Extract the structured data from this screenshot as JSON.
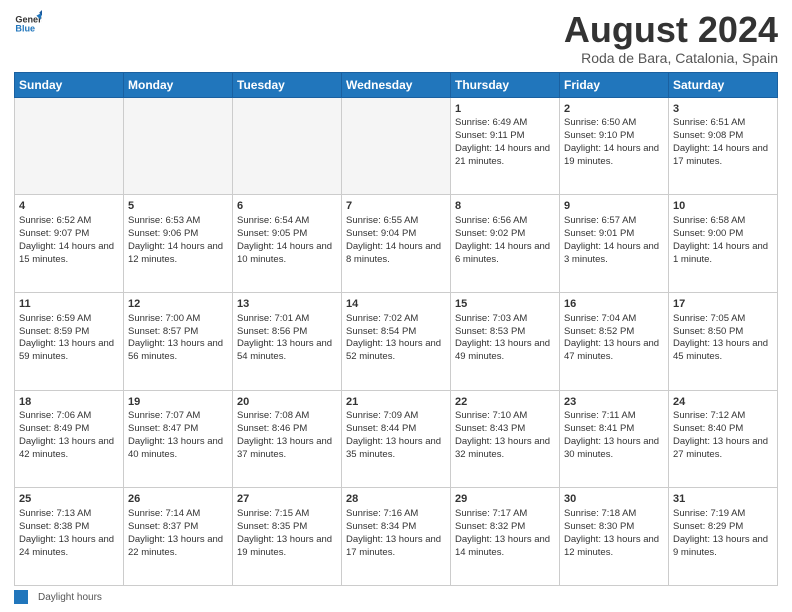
{
  "header": {
    "logo_line1": "General",
    "logo_line2": "Blue",
    "title": "August 2024",
    "subtitle": "Roda de Bara, Catalonia, Spain"
  },
  "days_of_week": [
    "Sunday",
    "Monday",
    "Tuesday",
    "Wednesday",
    "Thursday",
    "Friday",
    "Saturday"
  ],
  "footer": {
    "legend_label": "Daylight hours"
  },
  "weeks": [
    {
      "days": [
        {
          "num": "",
          "info": "",
          "empty": true
        },
        {
          "num": "",
          "info": "",
          "empty": true
        },
        {
          "num": "",
          "info": "",
          "empty": true
        },
        {
          "num": "",
          "info": "",
          "empty": true
        },
        {
          "num": "1",
          "info": "Sunrise: 6:49 AM\nSunset: 9:11 PM\nDaylight: 14 hours and 21 minutes.",
          "empty": false
        },
        {
          "num": "2",
          "info": "Sunrise: 6:50 AM\nSunset: 9:10 PM\nDaylight: 14 hours and 19 minutes.",
          "empty": false
        },
        {
          "num": "3",
          "info": "Sunrise: 6:51 AM\nSunset: 9:08 PM\nDaylight: 14 hours and 17 minutes.",
          "empty": false
        }
      ]
    },
    {
      "days": [
        {
          "num": "4",
          "info": "Sunrise: 6:52 AM\nSunset: 9:07 PM\nDaylight: 14 hours and 15 minutes.",
          "empty": false
        },
        {
          "num": "5",
          "info": "Sunrise: 6:53 AM\nSunset: 9:06 PM\nDaylight: 14 hours and 12 minutes.",
          "empty": false
        },
        {
          "num": "6",
          "info": "Sunrise: 6:54 AM\nSunset: 9:05 PM\nDaylight: 14 hours and 10 minutes.",
          "empty": false
        },
        {
          "num": "7",
          "info": "Sunrise: 6:55 AM\nSunset: 9:04 PM\nDaylight: 14 hours and 8 minutes.",
          "empty": false
        },
        {
          "num": "8",
          "info": "Sunrise: 6:56 AM\nSunset: 9:02 PM\nDaylight: 14 hours and 6 minutes.",
          "empty": false
        },
        {
          "num": "9",
          "info": "Sunrise: 6:57 AM\nSunset: 9:01 PM\nDaylight: 14 hours and 3 minutes.",
          "empty": false
        },
        {
          "num": "10",
          "info": "Sunrise: 6:58 AM\nSunset: 9:00 PM\nDaylight: 14 hours and 1 minute.",
          "empty": false
        }
      ]
    },
    {
      "days": [
        {
          "num": "11",
          "info": "Sunrise: 6:59 AM\nSunset: 8:59 PM\nDaylight: 13 hours and 59 minutes.",
          "empty": false
        },
        {
          "num": "12",
          "info": "Sunrise: 7:00 AM\nSunset: 8:57 PM\nDaylight: 13 hours and 56 minutes.",
          "empty": false
        },
        {
          "num": "13",
          "info": "Sunrise: 7:01 AM\nSunset: 8:56 PM\nDaylight: 13 hours and 54 minutes.",
          "empty": false
        },
        {
          "num": "14",
          "info": "Sunrise: 7:02 AM\nSunset: 8:54 PM\nDaylight: 13 hours and 52 minutes.",
          "empty": false
        },
        {
          "num": "15",
          "info": "Sunrise: 7:03 AM\nSunset: 8:53 PM\nDaylight: 13 hours and 49 minutes.",
          "empty": false
        },
        {
          "num": "16",
          "info": "Sunrise: 7:04 AM\nSunset: 8:52 PM\nDaylight: 13 hours and 47 minutes.",
          "empty": false
        },
        {
          "num": "17",
          "info": "Sunrise: 7:05 AM\nSunset: 8:50 PM\nDaylight: 13 hours and 45 minutes.",
          "empty": false
        }
      ]
    },
    {
      "days": [
        {
          "num": "18",
          "info": "Sunrise: 7:06 AM\nSunset: 8:49 PM\nDaylight: 13 hours and 42 minutes.",
          "empty": false
        },
        {
          "num": "19",
          "info": "Sunrise: 7:07 AM\nSunset: 8:47 PM\nDaylight: 13 hours and 40 minutes.",
          "empty": false
        },
        {
          "num": "20",
          "info": "Sunrise: 7:08 AM\nSunset: 8:46 PM\nDaylight: 13 hours and 37 minutes.",
          "empty": false
        },
        {
          "num": "21",
          "info": "Sunrise: 7:09 AM\nSunset: 8:44 PM\nDaylight: 13 hours and 35 minutes.",
          "empty": false
        },
        {
          "num": "22",
          "info": "Sunrise: 7:10 AM\nSunset: 8:43 PM\nDaylight: 13 hours and 32 minutes.",
          "empty": false
        },
        {
          "num": "23",
          "info": "Sunrise: 7:11 AM\nSunset: 8:41 PM\nDaylight: 13 hours and 30 minutes.",
          "empty": false
        },
        {
          "num": "24",
          "info": "Sunrise: 7:12 AM\nSunset: 8:40 PM\nDaylight: 13 hours and 27 minutes.",
          "empty": false
        }
      ]
    },
    {
      "days": [
        {
          "num": "25",
          "info": "Sunrise: 7:13 AM\nSunset: 8:38 PM\nDaylight: 13 hours and 24 minutes.",
          "empty": false
        },
        {
          "num": "26",
          "info": "Sunrise: 7:14 AM\nSunset: 8:37 PM\nDaylight: 13 hours and 22 minutes.",
          "empty": false
        },
        {
          "num": "27",
          "info": "Sunrise: 7:15 AM\nSunset: 8:35 PM\nDaylight: 13 hours and 19 minutes.",
          "empty": false
        },
        {
          "num": "28",
          "info": "Sunrise: 7:16 AM\nSunset: 8:34 PM\nDaylight: 13 hours and 17 minutes.",
          "empty": false
        },
        {
          "num": "29",
          "info": "Sunrise: 7:17 AM\nSunset: 8:32 PM\nDaylight: 13 hours and 14 minutes.",
          "empty": false
        },
        {
          "num": "30",
          "info": "Sunrise: 7:18 AM\nSunset: 8:30 PM\nDaylight: 13 hours and 12 minutes.",
          "empty": false
        },
        {
          "num": "31",
          "info": "Sunrise: 7:19 AM\nSunset: 8:29 PM\nDaylight: 13 hours and 9 minutes.",
          "empty": false
        }
      ]
    }
  ]
}
